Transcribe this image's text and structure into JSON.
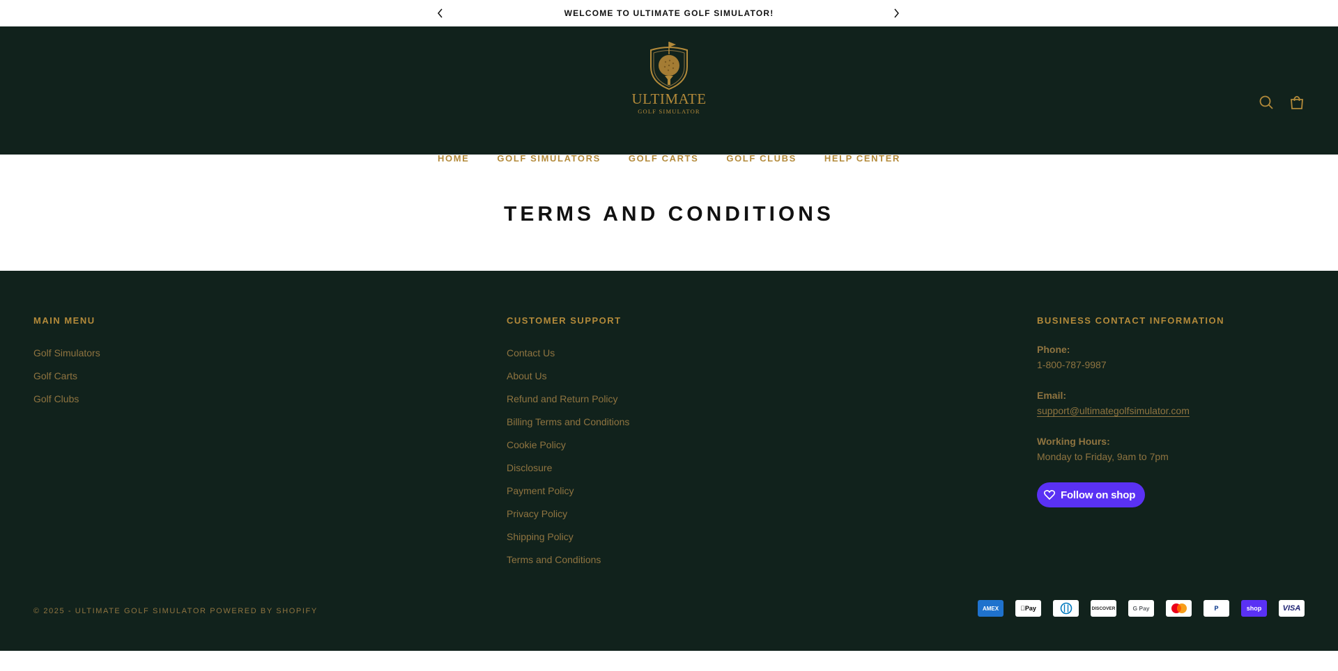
{
  "announcement": {
    "message": "WELCOME TO ULTIMATE GOLF SIMULATOR!",
    "prev_icon": "chevron-left-icon",
    "next_icon": "chevron-right-icon"
  },
  "header": {
    "logo_word1": "ULTIMATE",
    "logo_word2": "GOLF SIMULATOR",
    "icons": [
      "search-icon",
      "shopping-bag-icon"
    ],
    "nav": [
      "HOME",
      "GOLF SIMULATORS",
      "GOLF CARTS",
      "GOLF CLUBS",
      "HELP CENTER"
    ]
  },
  "page": {
    "title": "TERMS AND CONDITIONS"
  },
  "footer": {
    "main_menu": {
      "heading": "MAIN MENU",
      "links": [
        "Golf Simulators",
        "Golf Carts",
        "Golf Clubs"
      ]
    },
    "customer_support": {
      "heading": "CUSTOMER SUPPORT",
      "links": [
        "Contact Us",
        "About Us",
        "Refund and Return Policy",
        "Billing Terms and Conditions",
        "Cookie Policy",
        "Disclosure",
        "Payment Policy",
        "Privacy Policy",
        "Shipping Policy",
        "Terms and Conditions"
      ]
    },
    "business": {
      "heading": "BUSINESS CONTACT INFORMATION",
      "phone_label": "Phone:",
      "phone": "1-800-787-9987",
      "email_label": "Email:",
      "email": "support@ultimategolfsimulator.com",
      "hours_label": "Working Hours:",
      "hours": "Monday to Friday, 9am to 7pm",
      "shop_button": "Follow on shop"
    },
    "copyright": "© 2025 - ULTIMATE GOLF SIMULATOR POWERED BY SHOPIFY",
    "payments": [
      "AMEX",
      "Pay",
      "D",
      "DISCOVER",
      "G Pay",
      "mastercard",
      "P",
      "shop",
      "VISA"
    ]
  },
  "colors": {
    "dark_green": "#11221c",
    "gold": "#b38a3a",
    "gold_muted": "#8f7440",
    "shop_purple": "#5a31f4"
  }
}
